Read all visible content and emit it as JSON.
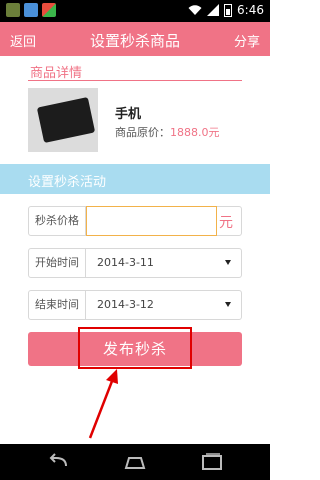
{
  "status_bar": {
    "time": "6:46"
  },
  "header": {
    "back_label": "返回",
    "title": "设置秒杀商品",
    "share_label": "分享"
  },
  "product_section": {
    "title": "商品详情",
    "name": "手机",
    "price_label": "商品原价：",
    "price_value": "1888.0元"
  },
  "activity_section": {
    "title": "设置秒杀活动",
    "price_field": {
      "label": "秒杀价格",
      "value": "",
      "unit": "元"
    },
    "start_field": {
      "label": "开始时间",
      "value": "2014-3-11"
    },
    "end_field": {
      "label": "结束时间",
      "value": "2014-3-12"
    }
  },
  "publish_button": {
    "label": "发布秒杀"
  },
  "colors": {
    "accent": "#f07386",
    "section_bar": "#a9dcf0",
    "input_focus": "#f2b24a",
    "annotation": "#e00000"
  },
  "icons": [
    "cat-app-icon",
    "image-icon",
    "apps-icon",
    "wifi-icon",
    "signal-icon",
    "battery-icon",
    "back-nav-icon",
    "home-nav-icon",
    "recents-nav-icon"
  ]
}
